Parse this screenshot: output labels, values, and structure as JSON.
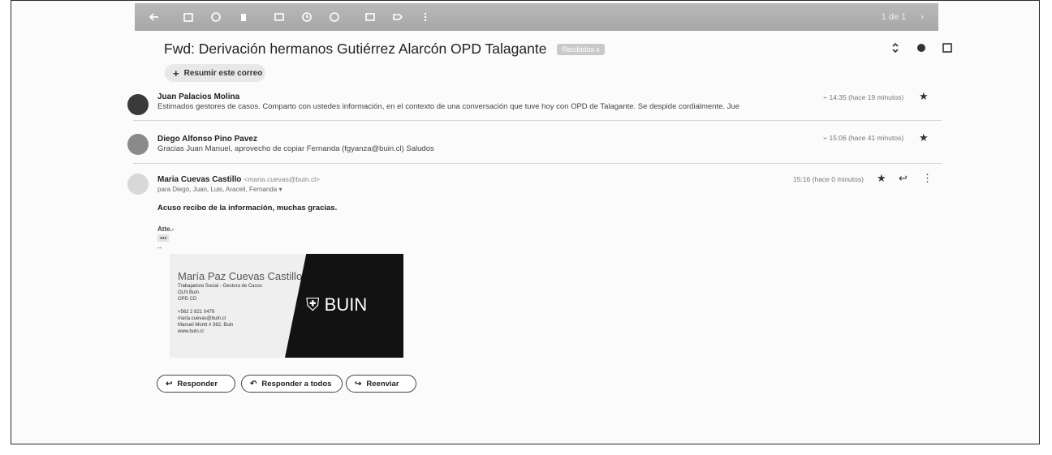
{
  "toolbar": {
    "icons": [
      "back-arrow-icon",
      "archive-icon",
      "report-spam-icon",
      "delete-icon",
      "mark-unread-icon",
      "snooze-icon",
      "add-task-icon",
      "move-icon",
      "label-icon",
      "more-vert-icon"
    ],
    "right_text": "1 de 1"
  },
  "subject": {
    "title": "Fwd: Derivación hermanos Gutiérrez Alarcón OPD Talagante",
    "tag": "Recibidos x"
  },
  "summarize_label": "Resumir este correo",
  "messages": [
    {
      "sender": "Juan Palacios Molina",
      "snippet": "Estimados gestores de casos. Comparto con ustedes información, en el contexto de una conversación que tuve hoy con OPD de Talagante. Se despide cordialmente. Jue",
      "time": "14:35 (hace 19 minutos)"
    },
    {
      "sender": "Diego Alfonso Pino Pavez",
      "snippet": "Gracias Juan Manuel, aprovecho de copiar Fernanda (fgyanza@buin.cl) Saludos",
      "time": "15:06 (hace 41 minutos)"
    },
    {
      "sender": "Maria Cuevas Castillo",
      "email": "<maria.cuevas@buin.cl>",
      "to": "para Diego, Juan, Luis, Araceli, Fernanda",
      "time": "15:16 (hace 0 minutos)",
      "body": "Acuso recibo de la información, muchas gracias.",
      "greeting": "Atte.-",
      "ellipsis": "•••"
    }
  ],
  "signature": {
    "name": "María Paz Cuevas Castillo",
    "lines": [
      "Trabajadora Social - Gestora de Casos",
      "OLN Buin",
      "OPD CD",
      "",
      "+562 2 821 0479",
      "maria.cuevas@buin.cl",
      "Manuel Montt # 382, Buin",
      "www.buin.cl"
    ],
    "logo_text": "BUIN"
  },
  "actions": {
    "reply": "Responder",
    "reply_all": "Responder a todos",
    "forward": "Reenviar"
  }
}
